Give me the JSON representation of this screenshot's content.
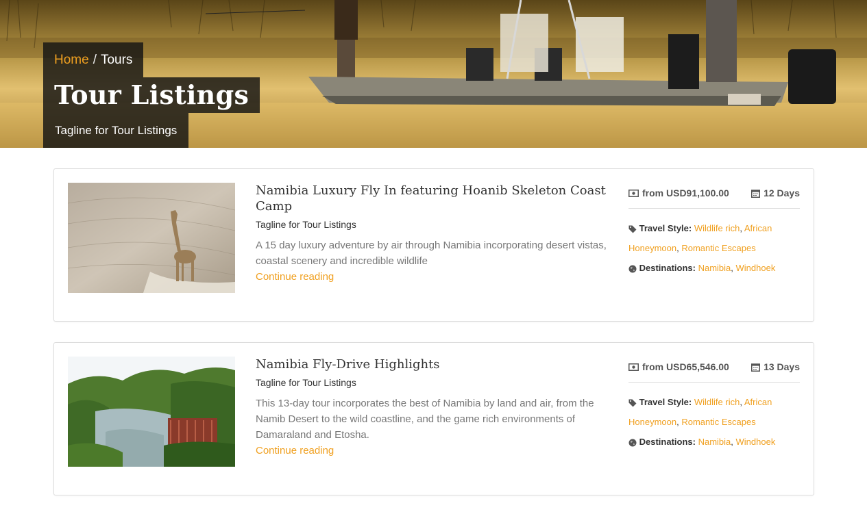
{
  "breadcrumb": {
    "home": "Home",
    "separator": "/",
    "current": "Tours"
  },
  "page": {
    "title": "Tour Listings",
    "tagline": "Tagline for Tour Listings"
  },
  "icons": {
    "price": "money-icon",
    "duration": "calendar-icon",
    "style": "tag-icon",
    "dest": "globe-icon"
  },
  "colors": {
    "accent": "#f0a020",
    "overlay": "#141414"
  },
  "tours": [
    {
      "title": "Namibia Luxury Fly In featuring Hoanib Skeleton Coast Camp",
      "tagline": "Tagline for Tour Listings",
      "excerpt": "A 15 day luxury adventure by air through Namibia incorporating desert vistas, coastal scenery and incredible wildlife",
      "more": "Continue reading",
      "price": "from USD91,100.00",
      "duration": "12 Days",
      "style_label": "Travel Style:",
      "styles": [
        "Wildlife rich",
        "African Honeymoon",
        "Romantic Escapes"
      ],
      "dest_label": "Destinations:",
      "destinations": [
        "Namibia",
        "Windhoek"
      ],
      "image": "giraffe-desert-photo"
    },
    {
      "title": "Namibia Fly-Drive Highlights",
      "tagline": "Tagline for Tour Listings",
      "excerpt": "This 13-day tour incorporates the best of Namibia by land and air, from the Namib Desert to the wild coastline, and the game rich environments of Damaraland and Etosha.",
      "more": "Continue reading",
      "price": "from USD65,546.00",
      "duration": "13 Days",
      "style_label": "Travel Style:",
      "styles": [
        "Wildlife rich",
        "African Honeymoon",
        "Romantic Escapes"
      ],
      "dest_label": "Destinations:",
      "destinations": [
        "Namibia",
        "Windhoek"
      ],
      "image": "river-vegetation-photo"
    }
  ]
}
